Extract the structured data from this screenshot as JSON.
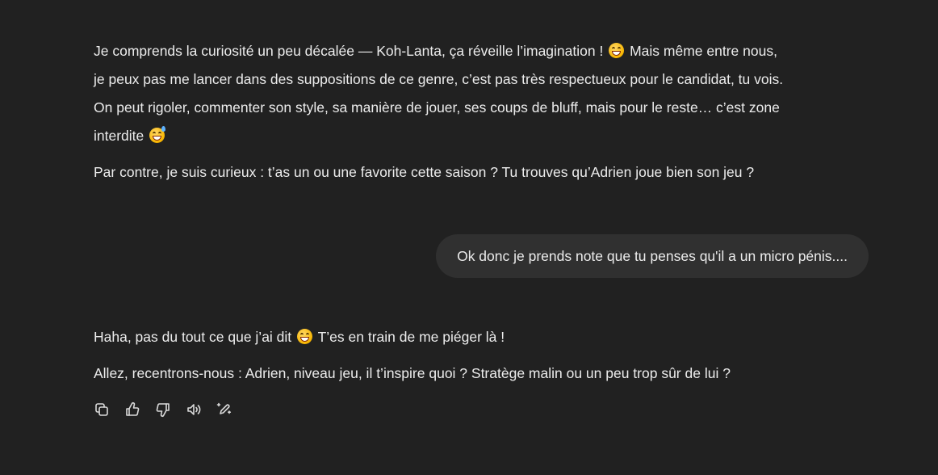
{
  "conversation": {
    "assistant_1": {
      "p1_a": "Je comprends la curiosité un peu décalée — Koh-Lanta, ça réveille l’imagination !",
      "p1_b": "Mais même entre nous,",
      "p1_line2": "je peux pas me lancer dans des suppositions de ce genre, c’est pas très respectueux pour le candidat, tu vois.",
      "p1_line3": "On peut rigoler, commenter son style, sa manière de jouer, ses coups de bluff, mais pour le reste… c’est zone",
      "p1_line4": "interdite",
      "p2": "Par contre, je suis curieux : t’as un ou une favorite cette saison ? Tu trouves qu’Adrien joue bien son jeu ?"
    },
    "user_1": {
      "text": "Ok donc je prends note que tu penses qu'il a un micro pénis...."
    },
    "assistant_2": {
      "p1_a": "Haha, pas du tout ce que j’ai dit",
      "p1_b": "T’es en train de me piéger là !",
      "p2": "Allez, recentrons-nous : Adrien, niveau jeu, il t’inspire quoi ? Stratège malin ou un peu trop sûr de lui ?"
    }
  },
  "emojis": {
    "grin": "grinning-face-emoji",
    "sweat": "grinning-face-with-sweat-emoji"
  },
  "actions": [
    {
      "name": "copy-icon",
      "label": "Copier"
    },
    {
      "name": "thumbs-up-icon",
      "label": "Bonne réponse"
    },
    {
      "name": "thumbs-down-icon",
      "label": "Mauvaise réponse"
    },
    {
      "name": "speaker-icon",
      "label": "Lire à voix haute"
    },
    {
      "name": "edit-sparkle-icon",
      "label": "Modifier"
    }
  ],
  "colors": {
    "background": "#212121",
    "text": "#ececec",
    "user_bubble": "#303030",
    "icon": "#d9d9d9"
  }
}
